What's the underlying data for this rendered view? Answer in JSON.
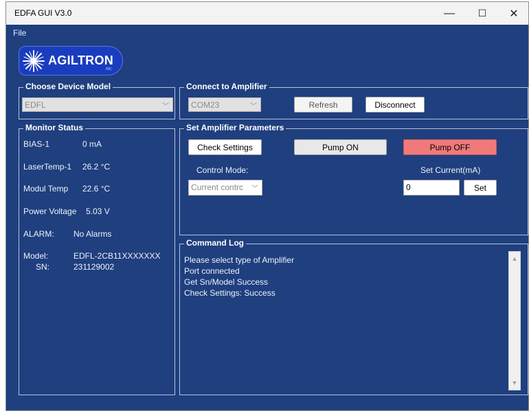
{
  "window": {
    "title": "EDFA GUI V3.0",
    "minimize": "—",
    "maximize": "☐",
    "close": "✕"
  },
  "menu": {
    "file": "File"
  },
  "logo": {
    "text": "AGILTRON",
    "inc": "INC"
  },
  "device_model": {
    "legend": "Choose Device Model",
    "value": "EDFL",
    "arrow": "﹀"
  },
  "connect": {
    "legend": "Connect to Amplifier",
    "port": "COM23",
    "arrow": "﹀",
    "refresh": "Refresh",
    "disconnect": "Disconnect"
  },
  "monitor": {
    "legend": "Monitor Status",
    "bias_label": "BIAS-1",
    "bias_value": "0 mA",
    "lasertemp_label": "LaserTemp-1",
    "lasertemp_value": "26.2 °C",
    "modultemp_label": "Modul Temp",
    "modultemp_value": "22.6 °C",
    "power_label": "Power Voltage",
    "power_value": "5.03 V",
    "alarm_label": "ALARM:",
    "alarm_value": "No Alarms",
    "model_label": "Model:",
    "model_value": "EDFL-2CB11XXXXXXX",
    "sn_label": "SN:",
    "sn_value": "231129002"
  },
  "params": {
    "legend": "Set Amplifier Parameters",
    "check_settings": "Check Settings",
    "pump_on": "Pump ON",
    "pump_off": "Pump OFF",
    "control_mode_label": "Control Mode:",
    "control_mode_value": "Current contrc",
    "arrow": "﹀",
    "set_current_label": "Set Current(mA)",
    "set_current_value": "0",
    "set": "Set"
  },
  "log": {
    "legend": "Command Log",
    "lines": [
      "Please select type of Amplifier",
      "Port connected",
      "Get Sn/Model Success",
      "Check Settings: Success"
    ],
    "scroll_up": "▲",
    "scroll_down": "▼"
  },
  "colors": {
    "background": "#1f3f7f",
    "logo_blue": "#1a3dbf",
    "pump_off": "#f07a7a"
  }
}
